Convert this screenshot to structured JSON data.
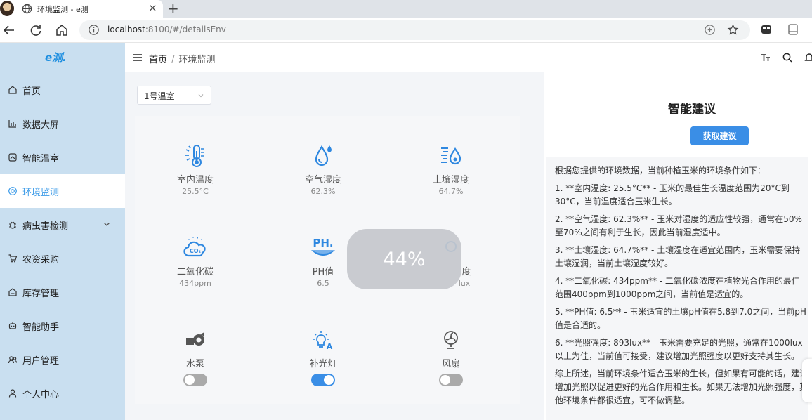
{
  "browser": {
    "tab_title": "环境监测 - e测",
    "url_host": "localhost",
    "url_rest": ":8100/#/detailsEnv"
  },
  "app": {
    "logo": "e测."
  },
  "sidebar": {
    "items": [
      {
        "label": "首页",
        "icon": "home-icon"
      },
      {
        "label": "数据大屏",
        "icon": "bar-chart-icon"
      },
      {
        "label": "智能温室",
        "icon": "greenhouse-icon"
      },
      {
        "label": "环境监测",
        "icon": "monitor-icon",
        "active": true
      },
      {
        "label": "病虫害检测",
        "icon": "bug-icon",
        "expandable": true
      },
      {
        "label": "农资采购",
        "icon": "cart-icon"
      },
      {
        "label": "库存管理",
        "icon": "warehouse-icon"
      },
      {
        "label": "智能助手",
        "icon": "robot-icon"
      },
      {
        "label": "用户管理",
        "icon": "users-icon"
      },
      {
        "label": "个人中心",
        "icon": "user-icon"
      }
    ]
  },
  "header": {
    "breadcrumb_home": "首页",
    "breadcrumb_sep": "/",
    "breadcrumb_current": "环境监测"
  },
  "greenhouse_select": {
    "value": "1号温室"
  },
  "sensors": [
    {
      "name": "室内温度",
      "value": "25.5°C",
      "icon": "thermometer-icon"
    },
    {
      "name": "空气湿度",
      "value": "62.3%",
      "icon": "droplet-icon"
    },
    {
      "name": "土壤湿度",
      "value": "64.7%",
      "icon": "soil-moisture-icon"
    },
    {
      "name": "二氧化碳",
      "value": "434ppm",
      "icon": "co2-icon"
    },
    {
      "name": "PH值",
      "value": "6.5",
      "icon": "ph-icon"
    },
    {
      "name": "度",
      "value": "lux",
      "icon": "light-intensity-icon"
    }
  ],
  "devices": [
    {
      "name": "水泵",
      "icon": "pump-icon",
      "on": false
    },
    {
      "name": "补光灯",
      "icon": "grow-light-icon",
      "on": true
    },
    {
      "name": "风扇",
      "icon": "fan-icon",
      "on": false
    }
  ],
  "advice": {
    "title": "智能建议",
    "button": "获取建议",
    "paragraphs": [
      "根据您提供的环境数据，当前种植玉米的环境条件如下：",
      "1. **室内温度: 25.5°C** - 玉米的最佳生长温度范围为20°C到30°C，当前温度适合玉米生长。",
      "2. **空气湿度: 62.3%** - 玉米对湿度的适应性较强，通常在50%至70%之间有利于生长，因此当前湿度适中。",
      "3. **土壤湿度: 64.7%** - 土壤湿度在适宜范围内，玉米需要保持土壤湿润，当前土壤湿度较好。",
      "4. **二氧化碳: 434ppm** - 二氧化碳浓度在植物光合作用的最佳范围400ppm到1000ppm之间，当前值是适宜的。",
      "5. **PH值: 6.5** - 玉米适宜的土壤pH值在5.8到7.0之间，当前pH值是合适的。",
      "6. **光照强度: 893lux** - 玉米需要充足的光照，通常在1000lux以上为佳，当前值可接受，建议增加光照强度以更好支持其生长。",
      "综上所述，当前环境条件适合玉米的生长，但如果有可能的话，建议增加光照以促进更好的光合作用和生长。如果无法增加光照强度，其他环境条件都很适宜，可不做调整。"
    ]
  },
  "overlay": {
    "progress_text": "44%"
  },
  "colors": {
    "sidebar_bg": "#c9dff0",
    "accent": "#3a8ee6",
    "sensor_icon": "#2f88e0"
  }
}
